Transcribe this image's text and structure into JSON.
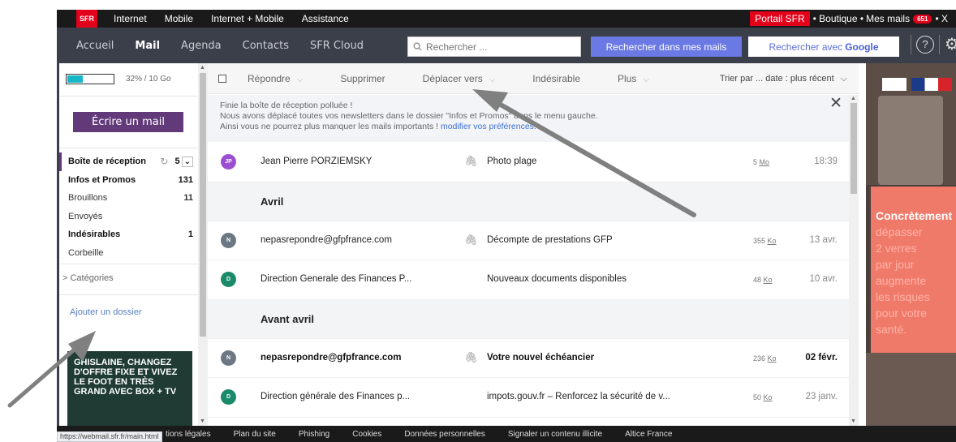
{
  "topbar": {
    "logo": "SFR",
    "links": [
      "Internet",
      "Mobile",
      "Internet + Mobile",
      "Assistance"
    ],
    "portail": "Portail SFR",
    "boutique": "• Boutique •",
    "mes_mails": "Mes mails",
    "mail_count": "651",
    "close": "• X"
  },
  "appbar": {
    "tabs": [
      "Accueil",
      "Mail",
      "Agenda",
      "Contacts",
      "SFR Cloud"
    ],
    "active_tab": "Mail",
    "search_placeholder": "Rechercher ...",
    "search_mail_button": "Rechercher dans mes mails",
    "search_google_prefix": "Rechercher avec",
    "search_google_brand": "Google",
    "help_icon_glyph": "?",
    "settings_icon_glyph": "⚙"
  },
  "sidebar": {
    "quota_text": "32% / 10 Go",
    "quota_fraction": 0.32,
    "compose_label": "Écrire un mail",
    "folders": [
      {
        "label": "Boîte de réception",
        "count": "5"
      },
      {
        "label": "Infos et Promos",
        "count": "131"
      },
      {
        "label": "Brouillons",
        "count": "11"
      },
      {
        "label": "Envoyés",
        "count": ""
      },
      {
        "label": "Indésirables",
        "count": "1"
      },
      {
        "label": "Corbeille",
        "count": ""
      }
    ],
    "categories_label": "> Catégories",
    "add_folder_label": "Ajouter un dossier",
    "promo_lines": [
      "GHISLAINE, CHANGEZ",
      "D'OFFRE FIXE ET VIVEZ",
      "LE FOOT EN TRÈS",
      "GRAND AVEC BOX + TV"
    ]
  },
  "toolbar": {
    "reply": "Répondre",
    "delete": "Supprimer",
    "move": "Déplacer vers",
    "spam": "Indésirable",
    "more": "Plus",
    "sort": "Trier par ... date : plus récent"
  },
  "banner": {
    "line1": "Finie la boîte de réception polluée !",
    "line2": "Nous avons déplacé toutes vos newsletters dans le dossier \"Infos et Promos\" dans le menu gauche.",
    "line3_text": "Ainsi vous ne pourrez plus manquer les mails importants !",
    "line3_link": "modifier vos préférences.",
    "close": "✕"
  },
  "groups": {
    "avril": "Avril",
    "avant_avril": "Avant avril"
  },
  "emails": [
    {
      "initials": "JP",
      "color": "#9b4fd0",
      "sender": "Jean Pierre PORZIEMSKY",
      "subject": "Photo plage",
      "attachment": true,
      "size": "5",
      "unit": "Mo",
      "time": "18:39",
      "unread": false
    },
    {
      "initials": "N",
      "color": "#6b7884",
      "sender": "nepasrepondre@gfpfrance.com",
      "subject": "Décompte de prestations GFP",
      "attachment": true,
      "size": "355",
      "unit": "Ko",
      "time": "13 avr.",
      "unread": false
    },
    {
      "initials": "D",
      "color": "#1a8a6a",
      "sender": "Direction Generale des Finances P...",
      "subject": "Nouveaux documents disponibles",
      "attachment": false,
      "size": "48",
      "unit": "Ko",
      "time": "10 avr.",
      "unread": false
    },
    {
      "initials": "N",
      "color": "#6b7884",
      "sender": "nepasrepondre@gfpfrance.com",
      "subject": "Votre nouvel échéancier",
      "attachment": true,
      "size": "236",
      "unit": "Ko",
      "time": "02 févr.",
      "unread": true
    },
    {
      "initials": "D",
      "color": "#1a8a6a",
      "sender": "Direction générale des Finances p...",
      "subject": "impots.gouv.fr – Renforcez la sécurité de v...",
      "attachment": false,
      "size": "50",
      "unit": "Ko",
      "time": "23 janv.",
      "unread": false
    }
  ],
  "ad": {
    "headline": "Concrètement",
    "lines": [
      "dépasser",
      "2 verres",
      "par jour",
      "augmente",
      "les risques",
      "pour votre",
      "santé."
    ]
  },
  "footer": {
    "url": "https://webmail.sfr.fr/main.html",
    "items": [
      "tions légales",
      "Plan du site",
      "Phishing",
      "Cookies",
      "Données personnelles",
      "Signaler un contenu illicite",
      "Altice France"
    ]
  }
}
